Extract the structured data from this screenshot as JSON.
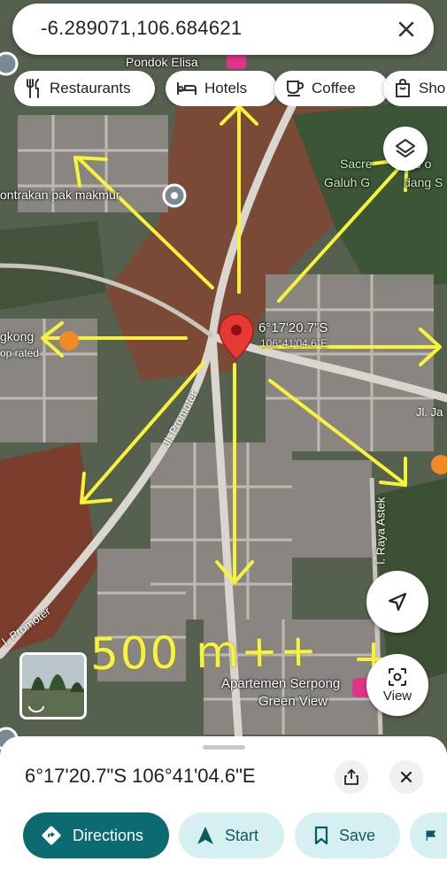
{
  "search": {
    "query": "-6.289071,106.684621"
  },
  "chips": [
    {
      "label": "Restaurants",
      "icon": "fork-knife-icon"
    },
    {
      "label": "Hotels",
      "icon": "bed-icon"
    },
    {
      "label": "Coffee",
      "icon": "coffee-cup-icon"
    },
    {
      "label": "Sho",
      "icon": "shopping-bag-icon"
    }
  ],
  "map_labels": {
    "pondok": "Pondok Elisa",
    "kontrakan": "ontrakan pak makmur",
    "sacred": "Sacre",
    "sacred_tail": "b o",
    "galuh": "Galuh G",
    "galuh_tail": "dang S",
    "gkong": "gkong",
    "top_rated": "op rated",
    "pin_coord": "6°17'20.7\"S",
    "pin_coord2": "106°41'04.6\"E",
    "street_promoter": "Jl. Promoter",
    "street_promoter2": "l. Promoter",
    "street_ja": "Jl. Ja",
    "street_astek": "l. Raya Astek",
    "apartemen1": "Apartemen Serpong",
    "apartemen2": "Green View"
  },
  "annotation": {
    "handwritten": "500 m++"
  },
  "view_button": {
    "label": "View"
  },
  "sheet": {
    "title": "6°17'20.7\"S 106°41'04.6\"E",
    "actions": [
      {
        "label": "Directions"
      },
      {
        "label": "Start"
      },
      {
        "label": "Save"
      }
    ]
  },
  "colors": {
    "primary": "#0b6b70",
    "secondary": "#d6f0f2",
    "pin": "#e53935",
    "annotation": "#f7f23a"
  }
}
